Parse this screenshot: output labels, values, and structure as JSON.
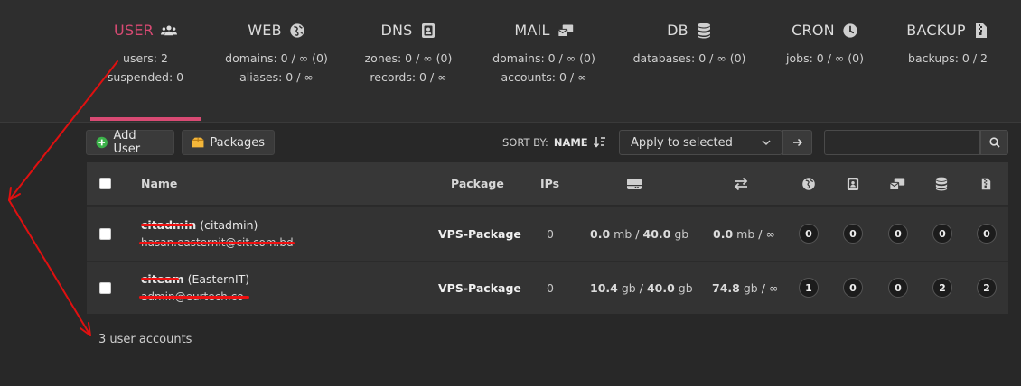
{
  "tabs": [
    {
      "id": "user",
      "label": "USER",
      "icon": "users-icon",
      "stats": [
        "users: 2",
        "suspended: 0"
      ],
      "active": true
    },
    {
      "id": "web",
      "label": "WEB",
      "icon": "globe-icon",
      "stats": [
        "domains: 0 / ∞ (0)",
        "aliases: 0 / ∞"
      ]
    },
    {
      "id": "dns",
      "label": "DNS",
      "icon": "address-book-icon",
      "stats": [
        "zones: 0 / ∞ (0)",
        "records: 0 / ∞"
      ]
    },
    {
      "id": "mail",
      "label": "MAIL",
      "icon": "mail-bulk-icon",
      "stats": [
        "domains: 0 / ∞ (0)",
        "accounts: 0 / ∞"
      ]
    },
    {
      "id": "db",
      "label": "DB",
      "icon": "database-icon",
      "stats": [
        "databases: 0 / ∞ (0)"
      ]
    },
    {
      "id": "cron",
      "label": "CRON",
      "icon": "clock-icon",
      "stats": [
        "jobs: 0 / ∞ (0)"
      ]
    },
    {
      "id": "backup",
      "label": "BACKUP",
      "icon": "file-zipper-icon",
      "stats": [
        "backups: 0 / 2"
      ]
    }
  ],
  "toolbar": {
    "add_user": "Add User",
    "packages": "Packages",
    "sort_by_label": "SORT BY:",
    "sort_by_value": "NAME",
    "bulk_action": "Apply to selected",
    "search_placeholder": ""
  },
  "table": {
    "headers": {
      "name": "Name",
      "package": "Package",
      "ips": "IPs"
    },
    "rows": [
      {
        "username": "citadmin",
        "fullname": "(citadmin)",
        "email": "hasan.easternit@cit.com.bd",
        "package": "VPS-Package",
        "ips": "0",
        "disk_used": "0.0",
        "disk_used_unit": "mb",
        "disk_quota": "40.0",
        "disk_quota_unit": "gb",
        "bw_used": "0.0",
        "bw_used_unit": "mb",
        "bw_quota": "∞",
        "web": "0",
        "dns": "0",
        "mail": "0",
        "db": "0",
        "backups": "0"
      },
      {
        "username": "citeam",
        "fullname": "(EasternIT)",
        "email": "admin@eurtech.co",
        "package": "VPS-Package",
        "ips": "0",
        "disk_used": "10.4",
        "disk_used_unit": "gb",
        "disk_quota": "40.0",
        "disk_quota_unit": "gb",
        "bw_used": "74.8",
        "bw_used_unit": "gb",
        "bw_quota": "∞",
        "web": "1",
        "dns": "0",
        "mail": "0",
        "db": "2",
        "backups": "2"
      }
    ]
  },
  "footer": {
    "count_text": "3 user accounts"
  },
  "colors": {
    "accent": "#d84a73",
    "annotation": "#e01010",
    "background": "#282828"
  }
}
